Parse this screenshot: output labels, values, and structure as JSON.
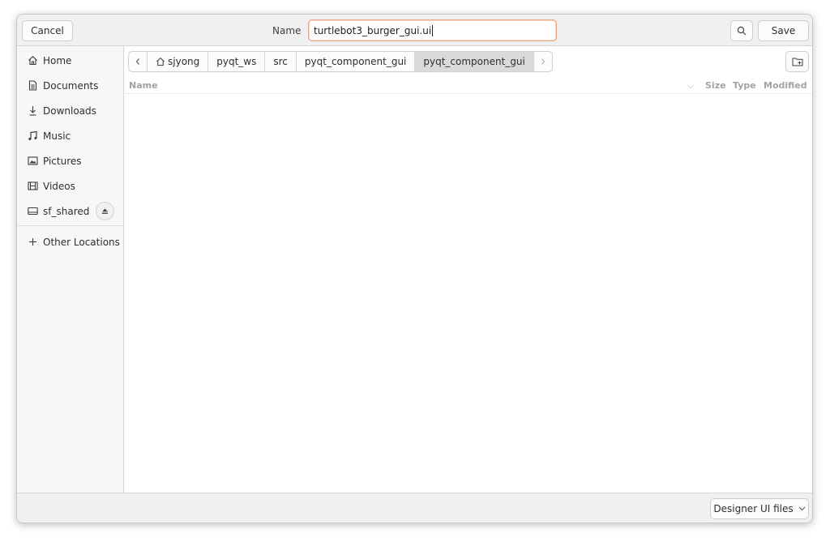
{
  "header": {
    "cancel_label": "Cancel",
    "name_label": "Name",
    "filename_value": "turtlebot3_burger_gui.ui",
    "save_label": "Save"
  },
  "sidebar": {
    "items": [
      {
        "label": "Home",
        "icon": "home-icon"
      },
      {
        "label": "Documents",
        "icon": "document-icon"
      },
      {
        "label": "Downloads",
        "icon": "download-icon"
      },
      {
        "label": "Music",
        "icon": "music-icon"
      },
      {
        "label": "Pictures",
        "icon": "pictures-icon"
      },
      {
        "label": "Videos",
        "icon": "videos-icon"
      },
      {
        "label": "sf_shared",
        "icon": "drive-icon"
      },
      {
        "label": "Other Locations",
        "icon": "plus-icon"
      }
    ]
  },
  "pathbar": {
    "crumbs": [
      "sjyong",
      "pyqt_ws",
      "src",
      "pyqt_component_gui",
      "pyqt_component_gui"
    ]
  },
  "columns": {
    "name": "Name",
    "size": "Size",
    "type": "Type",
    "modified": "Modified"
  },
  "footer": {
    "filter_label": "Designer UI files"
  },
  "colors": {
    "input_focus_border": "#e9a385",
    "active_crumb_bg": "#dadada"
  }
}
